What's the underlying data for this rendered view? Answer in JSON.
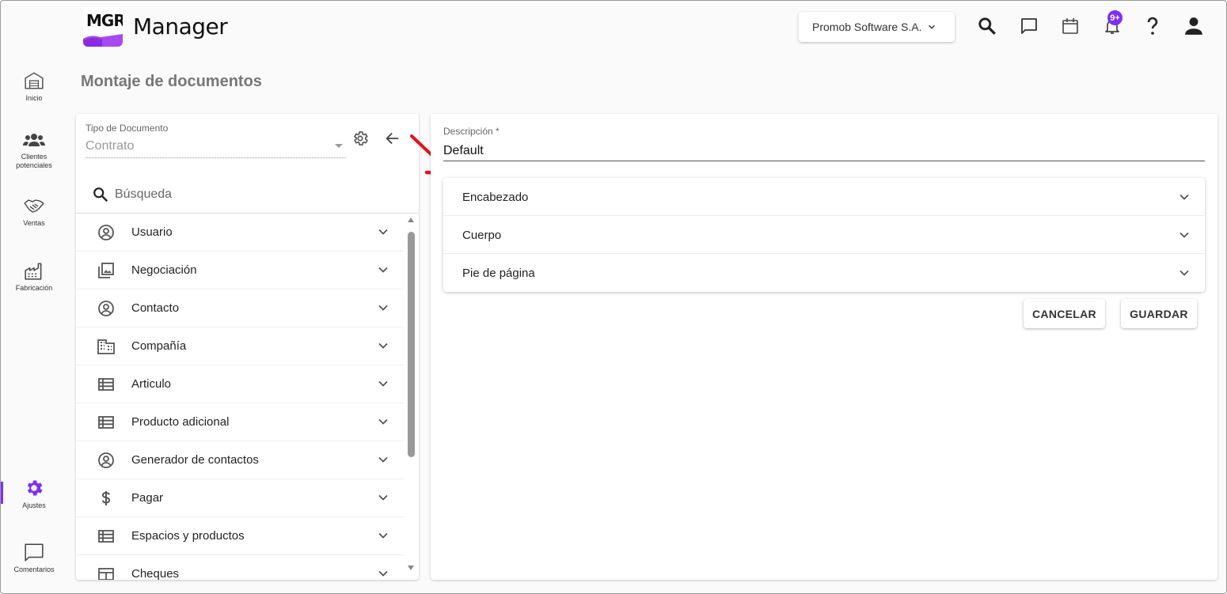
{
  "app": {
    "logo_text": "MGR",
    "title": "Manager"
  },
  "header": {
    "company": "Promob Software S.A.",
    "notification_badge": "9+"
  },
  "nav": {
    "items": [
      {
        "label": "Inicio",
        "icon": "warehouse-icon"
      },
      {
        "label": "Clientes potenciales",
        "icon": "people-icon"
      },
      {
        "label": "Ventas",
        "icon": "handshake-icon"
      },
      {
        "label": "Fabricación",
        "icon": "factory-icon"
      },
      {
        "label": "Ajustes",
        "icon": "gear-icon"
      },
      {
        "label": "Comentarios",
        "icon": "comment-icon"
      }
    ],
    "active": "Ajustes"
  },
  "page": {
    "title": "Montaje de documentos"
  },
  "left_panel": {
    "doc_type_label": "Tipo de Documento",
    "doc_type_value": "Contrato",
    "search_placeholder": "Búsqueda",
    "items": [
      {
        "label": "Usuario",
        "icon": "user-circle-icon"
      },
      {
        "label": "Negociación",
        "icon": "photo-library-icon"
      },
      {
        "label": "Contacto",
        "icon": "user-circle-icon"
      },
      {
        "label": "Compañía",
        "icon": "building-icon"
      },
      {
        "label": "Articulo",
        "icon": "list-icon"
      },
      {
        "label": "Producto adicional",
        "icon": "list-icon"
      },
      {
        "label": "Generador de contactos",
        "icon": "user-circle-icon"
      },
      {
        "label": "Pagar",
        "icon": "dollar-icon"
      },
      {
        "label": "Espacios y productos",
        "icon": "list-icon"
      },
      {
        "label": "Cheques",
        "icon": "table-icon"
      }
    ]
  },
  "right_panel": {
    "description_label": "Descripción *",
    "description_value": "Default",
    "sections": [
      {
        "label": "Encabezado"
      },
      {
        "label": "Cuerpo"
      },
      {
        "label": "Pie de página"
      }
    ],
    "cancel_label": "CANCELAR",
    "save_label": "GUARDAR"
  },
  "colors": {
    "accent": "#7b2ff7",
    "annotation": "#e8101a"
  }
}
